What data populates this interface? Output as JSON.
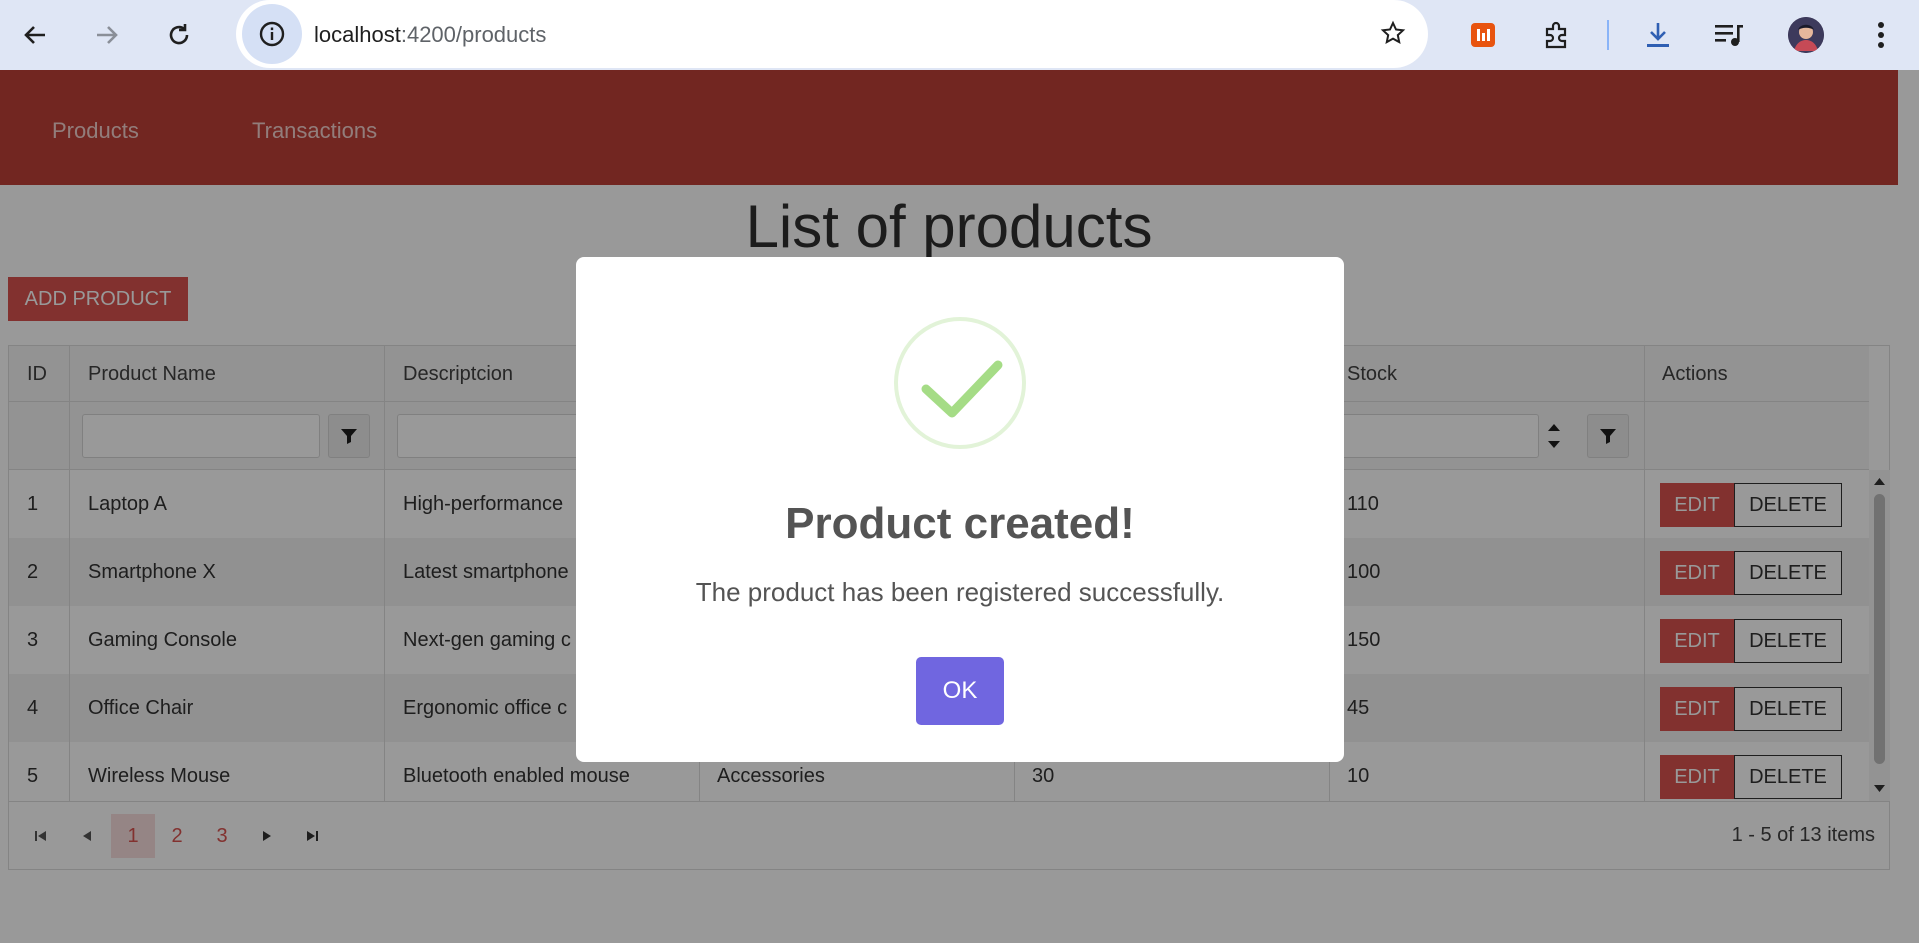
{
  "browser": {
    "url_host": "localhost",
    "url_path": ":4200/products"
  },
  "nav": {
    "products": "Products",
    "transactions": "Transactions"
  },
  "page": {
    "title": "List of products",
    "add_button": "ADD PRODUCT"
  },
  "table": {
    "headers": {
      "id": "ID",
      "name": "Product Name",
      "description": "Descriptcion",
      "stock": "Stock",
      "actions": "Actions"
    },
    "rows": [
      {
        "id": "1",
        "name": "Laptop A",
        "description": "High-performance",
        "stock": "110"
      },
      {
        "id": "2",
        "name": "Smartphone X",
        "description": "Latest smartphone",
        "stock": "100"
      },
      {
        "id": "3",
        "name": "Gaming Console",
        "description": "Next-gen gaming c",
        "stock": "150"
      },
      {
        "id": "4",
        "name": "Office Chair",
        "description": "Ergonomic office c",
        "stock": "45"
      },
      {
        "id": "5",
        "name": "Wireless Mouse",
        "description": "Bluetooth enabled mouse",
        "category": "Accessories",
        "price": "30",
        "stock": "10"
      }
    ],
    "edit_label": "EDIT",
    "delete_label": "DELETE",
    "pages": [
      "1",
      "2",
      "3"
    ],
    "pager_info": "1 - 5 of 13 items"
  },
  "modal": {
    "title": "Product created!",
    "text": "The product has been registered successfully.",
    "ok": "OK"
  },
  "colors": {
    "header": "#bf4038",
    "accent": "#d9534f",
    "ok_button": "#7066e0",
    "check": "#a5dc86"
  }
}
